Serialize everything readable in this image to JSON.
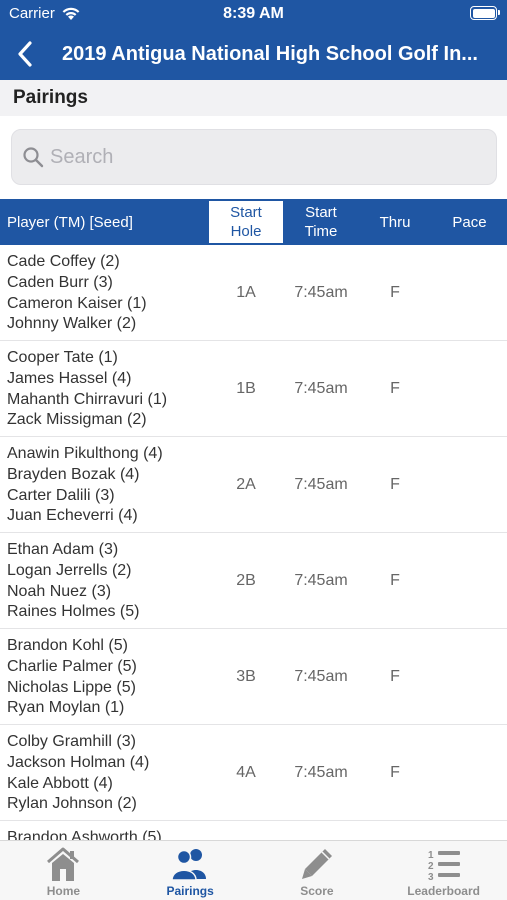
{
  "status": {
    "carrier": "Carrier",
    "time": "8:39 AM"
  },
  "header": {
    "title": "2019 Antigua National High School Golf In..."
  },
  "section": {
    "title": "Pairings"
  },
  "search": {
    "placeholder": "Search"
  },
  "table": {
    "columns": {
      "player": "Player (TM) [Seed]",
      "hole_line1": "Start",
      "hole_line2": "Hole",
      "time_line1": "Start",
      "time_line2": "Time",
      "thru": "Thru",
      "pace": "Pace"
    },
    "rows": [
      {
        "players": [
          "Cade Coffey (2)",
          "Caden Burr (3)",
          "Cameron Kaiser (1)",
          "Johnny Walker (2)"
        ],
        "hole": "1A",
        "time": "7:45am",
        "thru": "F"
      },
      {
        "players": [
          "Cooper Tate (1)",
          "James Hassel (4)",
          "Mahanth Chirravuri (1)",
          "Zack Missigman (2)"
        ],
        "hole": "1B",
        "time": "7:45am",
        "thru": "F"
      },
      {
        "players": [
          "Anawin Pikulthong (4)",
          "Brayden Bozak (4)",
          "Carter Dalili (3)",
          "Juan Echeverri (4)"
        ],
        "hole": "2A",
        "time": "7:45am",
        "thru": "F"
      },
      {
        "players": [
          "Ethan Adam (3)",
          "Logan Jerrells (2)",
          "Noah Nuez (3)",
          "Raines Holmes (5)"
        ],
        "hole": "2B",
        "time": "7:45am",
        "thru": "F"
      },
      {
        "players": [
          "Brandon Kohl (5)",
          "Charlie Palmer (5)",
          "Nicholas Lippe (5)",
          "Ryan Moylan (1)"
        ],
        "hole": "3B",
        "time": "7:45am",
        "thru": "F"
      },
      {
        "players": [
          "Colby Gramhill (3)",
          "Jackson Holman (4)",
          "Kale Abbott (4)",
          "Rylan Johnson (2)"
        ],
        "hole": "4A",
        "time": "7:45am",
        "thru": "F"
      },
      {
        "players": [
          "Brandon Ashworth (5)"
        ],
        "hole": "",
        "time": "",
        "thru": ""
      }
    ]
  },
  "tabs": [
    {
      "label": "Home",
      "icon": "home-icon",
      "active": false
    },
    {
      "label": "Pairings",
      "icon": "users-icon",
      "active": true
    },
    {
      "label": "Score",
      "icon": "pencil-icon",
      "active": false
    },
    {
      "label": "Leaderboard",
      "icon": "leaderboard-icon",
      "active": false
    }
  ],
  "colors": {
    "primary": "#1f56a3",
    "inactive_tab": "#8e8e8e"
  }
}
